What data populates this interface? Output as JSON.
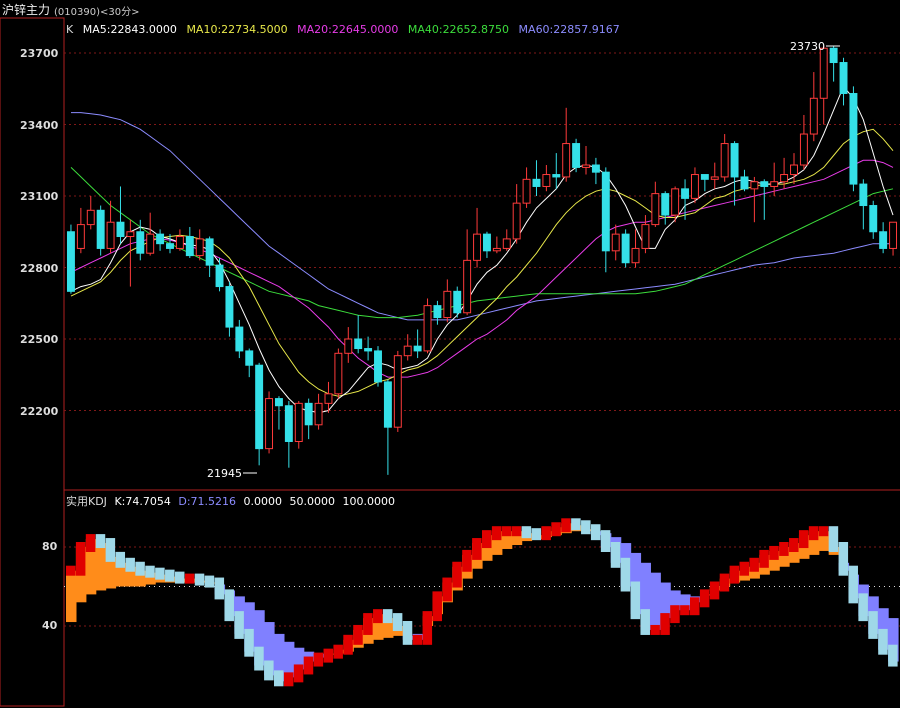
{
  "window": {
    "title": "沪锌主力",
    "code": "(010390)<30分>"
  },
  "legend": {
    "k_label": "K",
    "ma5": "MA5:22843.0000",
    "ma10": "MA10:22734.5000",
    "ma20": "MA20:22645.0000",
    "ma40": "MA40:22652.8750",
    "ma60": "MA60:22857.9167"
  },
  "kdj_legend": {
    "name": "实用KDJ",
    "k": "K:74.7054",
    "d": "D:71.5216",
    "v1": "0.0000",
    "v2": "50.0000",
    "v3": "100.0000"
  },
  "price_axis": {
    "ticks": [
      "23700",
      "23400",
      "23100",
      "22800",
      "22500",
      "22200"
    ]
  },
  "kdj_axis": {
    "ticks": [
      "80",
      "40"
    ]
  },
  "annotations": {
    "high": "23730",
    "low": "21945"
  },
  "colors": {
    "up": "#ff3b3b",
    "down": "#35e0e8",
    "ma5": "#ffffff",
    "ma10": "#e8e84a",
    "ma20": "#e83ce8",
    "ma40": "#3cdc3c",
    "ma60": "#8c8cff",
    "kdj_up": "#e00000",
    "kdj_down": "#9fd8e8",
    "fill_up": "#ff8c1a",
    "fill_down": "#8080ff"
  },
  "chart_data": {
    "type": "candlestick",
    "candles": [
      [
        22950,
        22700,
        22980,
        22690
      ],
      [
        22880,
        22980,
        23050,
        22860
      ],
      [
        22980,
        23040,
        23100,
        22960
      ],
      [
        23040,
        22880,
        23060,
        22850
      ],
      [
        22880,
        22990,
        23080,
        22860
      ],
      [
        22990,
        22930,
        23140,
        22900
      ],
      [
        22930,
        22950,
        23000,
        22720
      ],
      [
        22950,
        22860,
        23000,
        22830
      ],
      [
        22860,
        22940,
        23030,
        22850
      ],
      [
        22940,
        22900,
        22960,
        22870
      ],
      [
        22900,
        22880,
        22940,
        22860
      ],
      [
        22880,
        22930,
        22960,
        22870
      ],
      [
        22930,
        22850,
        22970,
        22840
      ],
      [
        22850,
        22920,
        22960,
        22830
      ],
      [
        22920,
        22810,
        22930,
        22760
      ],
      [
        22810,
        22720,
        22840,
        22700
      ],
      [
        22720,
        22550,
        22740,
        22510
      ],
      [
        22550,
        22450,
        22580,
        22420
      ],
      [
        22450,
        22390,
        22460,
        22340
      ],
      [
        22390,
        22040,
        22400,
        21970
      ],
      [
        22040,
        22250,
        22280,
        22020
      ],
      [
        22250,
        22220,
        22260,
        22120
      ],
      [
        22220,
        22070,
        22240,
        21960
      ],
      [
        22070,
        22230,
        22240,
        22040
      ],
      [
        22230,
        22140,
        22250,
        22080
      ],
      [
        22140,
        22230,
        22270,
        22120
      ],
      [
        22230,
        22270,
        22320,
        22190
      ],
      [
        22270,
        22440,
        22460,
        22250
      ],
      [
        22440,
        22500,
        22550,
        22400
      ],
      [
        22500,
        22460,
        22600,
        22440
      ],
      [
        22460,
        22450,
        22510,
        22410
      ],
      [
        22450,
        22320,
        22470,
        22300
      ],
      [
        22320,
        22130,
        22330,
        21930
      ],
      [
        22130,
        22430,
        22450,
        22110
      ],
      [
        22430,
        22470,
        22520,
        22410
      ],
      [
        22470,
        22450,
        22540,
        22420
      ],
      [
        22450,
        22640,
        22670,
        22440
      ],
      [
        22640,
        22590,
        22660,
        22560
      ],
      [
        22590,
        22700,
        22750,
        22570
      ],
      [
        22700,
        22610,
        22720,
        22590
      ],
      [
        22610,
        22830,
        22960,
        22600
      ],
      [
        22830,
        22940,
        23050,
        22800
      ],
      [
        22940,
        22870,
        22950,
        22840
      ],
      [
        22870,
        22880,
        22930,
        22860
      ],
      [
        22880,
        22920,
        22960,
        22870
      ],
      [
        22920,
        23070,
        23150,
        22900
      ],
      [
        23070,
        23170,
        23220,
        23050
      ],
      [
        23170,
        23140,
        23250,
        23100
      ],
      [
        23140,
        23190,
        23230,
        23120
      ],
      [
        23190,
        23180,
        23280,
        23130
      ],
      [
        23180,
        23320,
        23470,
        23160
      ],
      [
        23320,
        23220,
        23340,
        23200
      ],
      [
        23220,
        23230,
        23310,
        23190
      ],
      [
        23230,
        23200,
        23260,
        23150
      ],
      [
        23200,
        22870,
        23220,
        22780
      ],
      [
        22870,
        22940,
        22980,
        22830
      ],
      [
        22940,
        22820,
        22960,
        22800
      ],
      [
        22820,
        22880,
        22960,
        22800
      ],
      [
        22880,
        22980,
        23020,
        22860
      ],
      [
        22980,
        23110,
        23160,
        22970
      ],
      [
        23110,
        23020,
        23120,
        22980
      ],
      [
        23020,
        23130,
        23140,
        22990
      ],
      [
        23130,
        23090,
        23170,
        23000
      ],
      [
        23090,
        23190,
        23220,
        23070
      ],
      [
        23190,
        23170,
        23190,
        23120
      ],
      [
        23170,
        23180,
        23240,
        23130
      ],
      [
        23180,
        23320,
        23360,
        23160
      ],
      [
        23320,
        23180,
        23330,
        23060
      ],
      [
        23180,
        23130,
        23210,
        23120
      ],
      [
        23130,
        23160,
        23180,
        22990
      ],
      [
        23160,
        23140,
        23170,
        23000
      ],
      [
        23140,
        23160,
        23240,
        23100
      ],
      [
        23160,
        23190,
        23260,
        23130
      ],
      [
        23190,
        23230,
        23280,
        23150
      ],
      [
        23230,
        23360,
        23440,
        23210
      ],
      [
        23360,
        23510,
        23620,
        23330
      ],
      [
        23510,
        23720,
        23730,
        23400
      ],
      [
        23720,
        23660,
        23730,
        23580
      ],
      [
        23660,
        23530,
        23680,
        23480
      ],
      [
        23530,
        23150,
        23560,
        23120
      ],
      [
        23150,
        23060,
        23170,
        22960
      ],
      [
        23060,
        22950,
        23080,
        22920
      ],
      [
        22950,
        22880,
        22990,
        22860
      ],
      [
        22880,
        22990,
        22990,
        22850
      ]
    ],
    "ma5": [
      22700,
      22720,
      22730,
      22750,
      22820,
      22900,
      22950,
      22970,
      22960,
      22930,
      22920,
      22905,
      22895,
      22890,
      22875,
      22820,
      22740,
      22650,
      22560,
      22460,
      22370,
      22300,
      22250,
      22210,
      22200,
      22190,
      22200,
      22250,
      22280,
      22330,
      22380,
      22400,
      22390,
      22370,
      22380,
      22390,
      22420,
      22500,
      22560,
      22600,
      22660,
      22730,
      22780,
      22810,
      22860,
      22920,
      22990,
      23050,
      23090,
      23130,
      23190,
      23220,
      23230,
      23220,
      23190,
      23130,
      23060,
      22970,
      22880,
      22880,
      22960,
      23000,
      23060,
      23080,
      23110,
      23130,
      23140,
      23160,
      23170,
      23160,
      23150,
      23150,
      23160,
      23180,
      23210,
      23270,
      23360,
      23460,
      23560,
      23510,
      23420,
      23280,
      23140,
      23020
    ],
    "ma10": [
      22680,
      22700,
      22720,
      22740,
      22780,
      22830,
      22870,
      22890,
      22910,
      22925,
      22930,
      22935,
      22930,
      22920,
      22910,
      22880,
      22840,
      22780,
      22720,
      22640,
      22560,
      22480,
      22420,
      22360,
      22320,
      22290,
      22270,
      22260,
      22270,
      22280,
      22300,
      22320,
      22330,
      22350,
      22370,
      22380,
      22400,
      22430,
      22470,
      22510,
      22550,
      22590,
      22630,
      22670,
      22720,
      22760,
      22810,
      22860,
      22920,
      22980,
      23030,
      23070,
      23100,
      23120,
      23130,
      23120,
      23100,
      23080,
      23050,
      23020,
      23010,
      23010,
      23020,
      23030,
      23060,
      23090,
      23100,
      23120,
      23130,
      23140,
      23150,
      23150,
      23150,
      23160,
      23170,
      23190,
      23220,
      23270,
      23320,
      23350,
      23370,
      23380,
      23340,
      23290
    ],
    "ma20": [
      22780,
      22800,
      22820,
      22840,
      22860,
      22880,
      22900,
      22910,
      22920,
      22920,
      22915,
      22905,
      22890,
      22875,
      22860,
      22840,
      22820,
      22800,
      22780,
      22760,
      22740,
      22720,
      22690,
      22660,
      22630,
      22590,
      22550,
      22500,
      22460,
      22420,
      22390,
      22360,
      22340,
      22340,
      22340,
      22350,
      22360,
      22380,
      22410,
      22440,
      22470,
      22500,
      22520,
      22550,
      22580,
      22620,
      22650,
      22680,
      22720,
      22760,
      22800,
      22840,
      22880,
      22920,
      22950,
      22970,
      22980,
      22990,
      22990,
      23000,
      23010,
      23020,
      23030,
      23040,
      23050,
      23060,
      23070,
      23080,
      23090,
      23100,
      23110,
      23120,
      23130,
      23140,
      23150,
      23160,
      23170,
      23190,
      23210,
      23230,
      23250,
      23250,
      23240,
      23220
    ],
    "ma40": [
      23220,
      23180,
      23140,
      23100,
      23060,
      23030,
      23000,
      22970,
      22940,
      22920,
      22900,
      22880,
      22860,
      22840,
      22820,
      22800,
      22780,
      22760,
      22740,
      22720,
      22700,
      22690,
      22680,
      22670,
      22660,
      22640,
      22630,
      22620,
      22610,
      22600,
      22595,
      22590,
      22590,
      22590,
      22595,
      22600,
      22610,
      22620,
      22630,
      22640,
      22650,
      22660,
      22665,
      22670,
      22675,
      22680,
      22685,
      22690,
      22690,
      22690,
      22690,
      22690,
      22690,
      22690,
      22690,
      22690,
      22690,
      22690,
      22695,
      22700,
      22710,
      22720,
      22730,
      22750,
      22770,
      22790,
      22810,
      22830,
      22850,
      22870,
      22890,
      22910,
      22930,
      22950,
      22970,
      22990,
      23010,
      23030,
      23050,
      23070,
      23090,
      23110,
      23120,
      23130
    ],
    "ma60": [
      23450,
      23450,
      23445,
      23440,
      23430,
      23420,
      23400,
      23380,
      23350,
      23320,
      23290,
      23250,
      23210,
      23170,
      23130,
      23090,
      23050,
      23010,
      22970,
      22930,
      22890,
      22860,
      22830,
      22800,
      22770,
      22740,
      22710,
      22690,
      22670,
      22650,
      22630,
      22610,
      22600,
      22590,
      22580,
      22580,
      22580,
      22580,
      22580,
      22580,
      22590,
      22600,
      22610,
      22620,
      22630,
      22640,
      22650,
      22660,
      22665,
      22670,
      22675,
      22680,
      22685,
      22690,
      22695,
      22700,
      22705,
      22710,
      22715,
      22720,
      22725,
      22730,
      22740,
      22750,
      22760,
      22770,
      22780,
      22790,
      22800,
      22810,
      22815,
      22820,
      22830,
      22840,
      22845,
      22850,
      22855,
      22860,
      22870,
      22880,
      22890,
      22900,
      22900,
      22900
    ]
  },
  "kdj_data": {
    "k": [
      68,
      80,
      84,
      82,
      75,
      72,
      70,
      68,
      67,
      66,
      65,
      64,
      64,
      63,
      62,
      56,
      45,
      36,
      27,
      20,
      15,
      12,
      14,
      18,
      22,
      24,
      26,
      28,
      33,
      38,
      44,
      46,
      44,
      40,
      33,
      33,
      45,
      55,
      62,
      70,
      76,
      82,
      86,
      88,
      88,
      88,
      87,
      86,
      88,
      90,
      92,
      91,
      89,
      86,
      80,
      72,
      60,
      46,
      38,
      38,
      44,
      48,
      48,
      52,
      56,
      60,
      64,
      68,
      70,
      72,
      76,
      78,
      80,
      82,
      86,
      88,
      88,
      80,
      68,
      54,
      45,
      36,
      28,
      22,
      18
    ],
    "d": [
      42,
      52,
      56,
      58,
      59,
      60,
      60,
      60,
      61,
      62,
      62,
      62,
      62,
      62,
      62,
      61,
      58,
      55,
      52,
      48,
      42,
      36,
      32,
      29,
      27,
      26,
      26,
      26,
      27,
      29,
      31,
      33,
      34,
      35,
      35,
      36,
      40,
      46,
      52,
      58,
      64,
      69,
      73,
      76,
      79,
      81,
      83,
      84,
      85,
      86,
      87,
      88,
      88,
      88,
      87,
      85,
      82,
      77,
      72,
      67,
      62,
      58,
      56,
      55,
      56,
      58,
      60,
      62,
      63,
      64,
      66,
      68,
      70,
      72,
      74,
      76,
      78,
      76,
      72,
      66,
      61,
      55,
      49,
      44,
      40
    ]
  }
}
